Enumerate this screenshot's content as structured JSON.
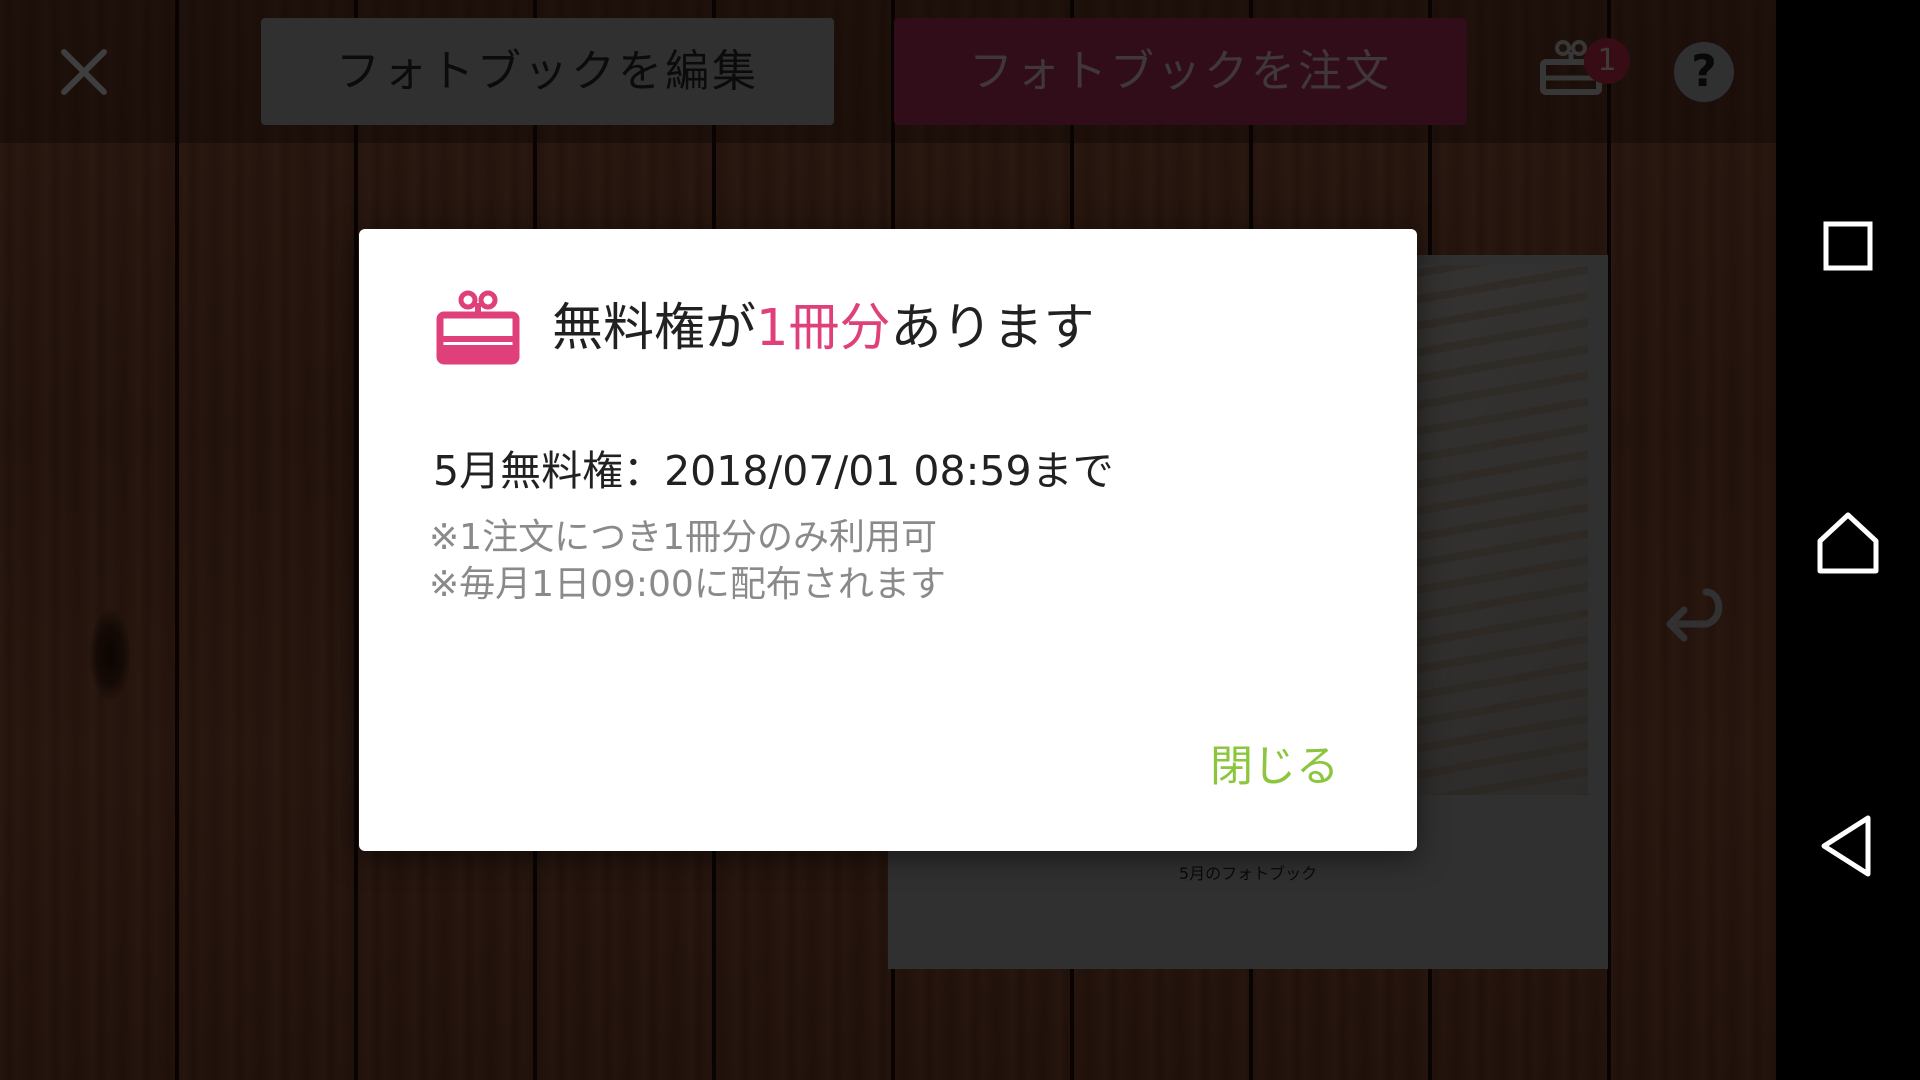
{
  "toolbar": {
    "close_icon": "close-icon",
    "edit_label": "フォトブックを編集",
    "order_label": "フォトブックを注文",
    "gift_icon": "gift-icon",
    "gift_badge_count": "1",
    "help_label": "?"
  },
  "book": {
    "caption": "5月のフォトブック"
  },
  "dialog": {
    "title_prefix": "無料権が",
    "title_highlight": "1冊分",
    "title_suffix": "あります",
    "expiry": "5月無料権：2018/07/01 08:59まで",
    "note_1": "※1注文につき1冊分のみ利用可",
    "note_2": "※毎月1日09:00に配布されます",
    "close_label": "閉じる"
  },
  "nav": {
    "recents_icon": "square-icon",
    "home_icon": "home-icon",
    "back_icon": "back-triangle-icon"
  },
  "colors": {
    "accent_pink": "#e0407a",
    "close_green": "#8cc63f",
    "order_button": "#6e1e38",
    "edit_button": "#6e6c6a"
  }
}
